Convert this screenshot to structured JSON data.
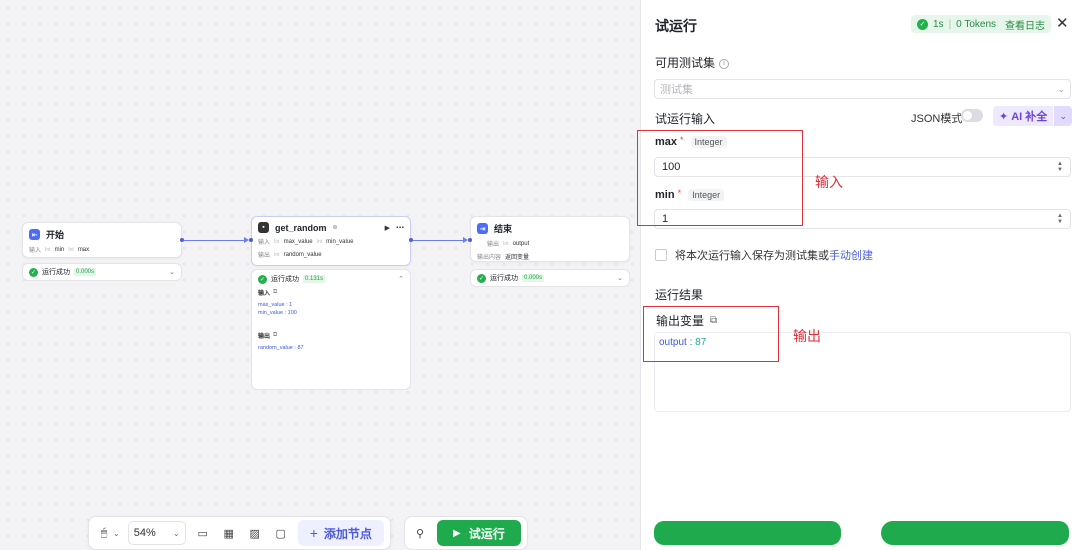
{
  "canvas": {
    "nodes": {
      "start": {
        "title": "开始",
        "input_label": "输入",
        "fields": [
          "min",
          "max"
        ],
        "status": "运行成功",
        "time": "0.000s"
      },
      "get_random": {
        "title": "get_random",
        "input_label": "输入",
        "output_label": "输出",
        "inputs": [
          "max_value",
          "min_value"
        ],
        "outputs": [
          "random_value"
        ],
        "status": "运行成功",
        "time": "0.131s",
        "detail_input_label": "输入",
        "detail_inputs": [
          "max_value : 1",
          "min_value : 100"
        ],
        "detail_output_label": "输出",
        "detail_outputs": [
          "random_value : 87"
        ]
      },
      "end": {
        "title": "结束",
        "output_label": "输出",
        "output_field": "output",
        "answer_label": "输出内容",
        "answer_value": "返回变量",
        "status": "运行成功",
        "time": "0.000s"
      }
    },
    "toolbar": {
      "zoom": "54%",
      "add_node": "添加节点",
      "run": "试运行"
    }
  },
  "panel": {
    "title": "试运行",
    "stat_time": "1s",
    "stat_tokens": "0 Tokens",
    "stat_log": "查看日志",
    "testset_label": "可用测试集",
    "testset_placeholder": "测试集",
    "input_section": "试运行输入",
    "json_mode": "JSON模式",
    "ai_fill": "AI 补全",
    "fields": [
      {
        "name": "max",
        "type": "Integer",
        "value": "100"
      },
      {
        "name": "min",
        "type": "Integer",
        "value": "1"
      }
    ],
    "save_text": "将本次运行输入保存为测试集或",
    "save_link": "手动创建",
    "result_section": "运行结果",
    "output_var_label": "输出变量",
    "output_key": "output",
    "output_value": "87"
  },
  "annotations": {
    "input_note": "输入",
    "output_note": "输出"
  }
}
